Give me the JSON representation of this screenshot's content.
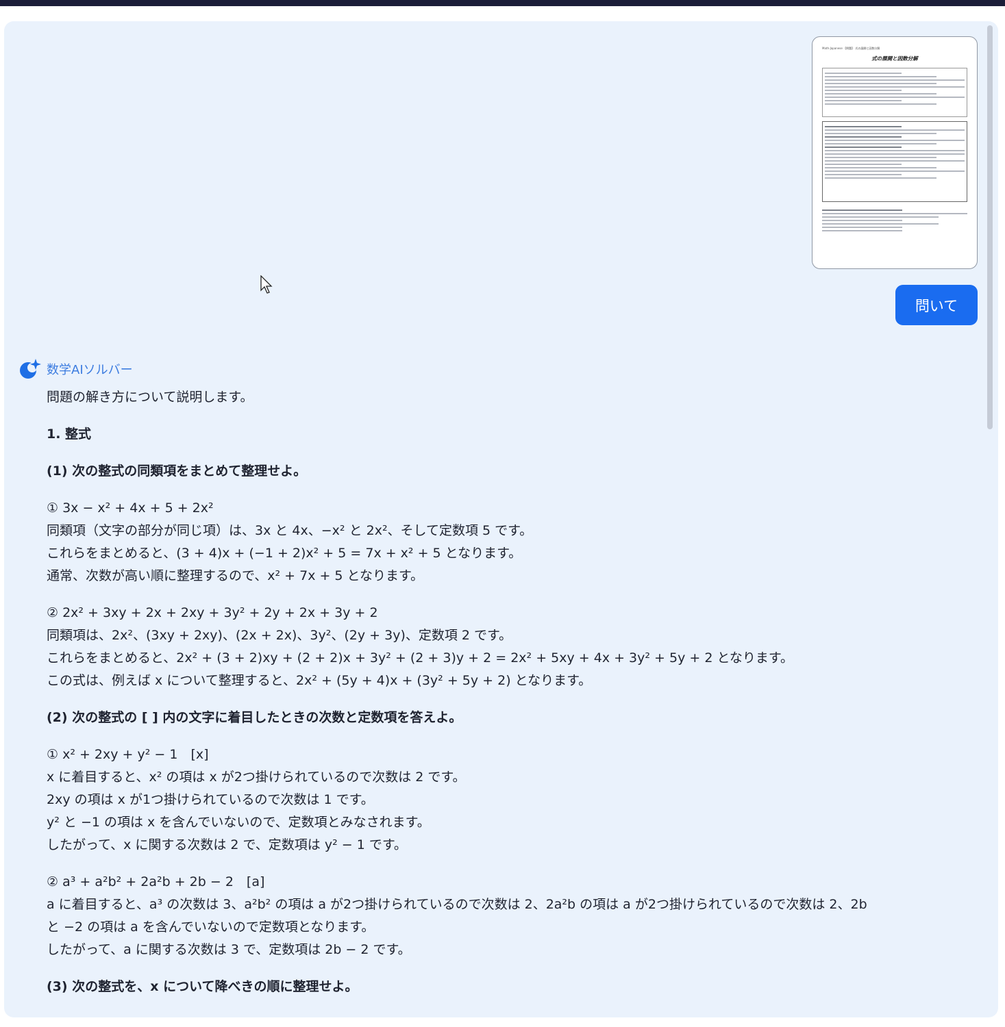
{
  "ask_button": {
    "label": "問いて"
  },
  "assistant": {
    "name": "数学AIソルバー"
  },
  "thumbnail": {
    "header": "Math-Japanese 【問題】 式の展開と因数分解",
    "title": "式の展開と因数分解"
  },
  "answer": {
    "intro": "問題の解き方について説明します。",
    "section1": "1. 整式",
    "q1": "(1) 次の整式の同類項をまとめて整理せよ。",
    "q1_1_head": "① 3x − x² + 4x + 5 + 2x²",
    "q1_1_l1": "同類項（文字の部分が同じ項）は、3x と 4x、−x² と 2x²、そして定数項 5 です。",
    "q1_1_l2": "これらをまとめると、(3 + 4)x + (−1 + 2)x² + 5 = 7x + x² + 5 となります。",
    "q1_1_l3": "通常、次数が高い順に整理するので、x² + 7x + 5 となります。",
    "q1_2_head": "② 2x² + 3xy + 2x + 2xy + 3y² + 2y + 2x + 3y + 2",
    "q1_2_l1": "同類項は、2x²、(3xy + 2xy)、(2x + 2x)、3y²、(2y + 3y)、定数項 2 です。",
    "q1_2_l2": "これらをまとめると、2x² + (3 + 2)xy + (2 + 2)x + 3y² + (2 + 3)y + 2 = 2x² + 5xy + 4x + 3y² + 5y + 2 となります。",
    "q1_2_l3": "この式は、例えば x について整理すると、2x² + (5y + 4)x + (3y² + 5y + 2) となります。",
    "q2": "(2) 次の整式の [ ] 内の文字に着目したときの次数と定数項を答えよ。",
    "q2_1_head": "① x² + 2xy + y² − 1　[x]",
    "q2_1_l1": "x に着目すると、x² の項は x が2つ掛けられているので次数は 2 です。",
    "q2_1_l2": "2xy の項は x が1つ掛けられているので次数は 1 です。",
    "q2_1_l3": "y² と −1 の項は x を含んでいないので、定数項とみなされます。",
    "q2_1_l4": "したがって、x に関する次数は 2 で、定数項は y² − 1 です。",
    "q2_2_head": "② a³ + a²b² + 2a²b + 2b − 2　[a]",
    "q2_2_l1": "a に着目すると、a³ の次数は 3、a²b² の項は a が2つ掛けられているので次数は 2、2a²b の項は a が2つ掛けられているので次数は 2、2b",
    "q2_2_l2": "と −2 の項は a を含んでいないので定数項となります。",
    "q2_2_l3": "したがって、a に関する次数は 3 で、定数項は 2b − 2 です。",
    "q3": "(3) 次の整式を、x について降べきの順に整理せよ。"
  },
  "colors": {
    "accent": "#1a6cf0",
    "panel_bg": "#eaf2fc",
    "topbar": "#1b1d38"
  }
}
